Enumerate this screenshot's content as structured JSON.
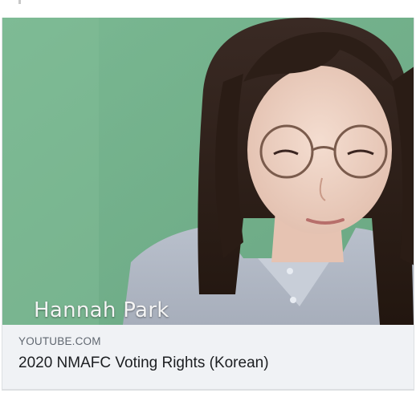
{
  "link_preview": {
    "video_caption": "Hannah Park",
    "source_domain": "YOUTUBE.COM",
    "title": "2020 NMAFC Voting Rights (Korean)"
  },
  "colors": {
    "backdrop_green": "#80b996",
    "footer_background": "#f0f2f5",
    "source_text": "#606770",
    "title_text": "#1c1e21"
  }
}
